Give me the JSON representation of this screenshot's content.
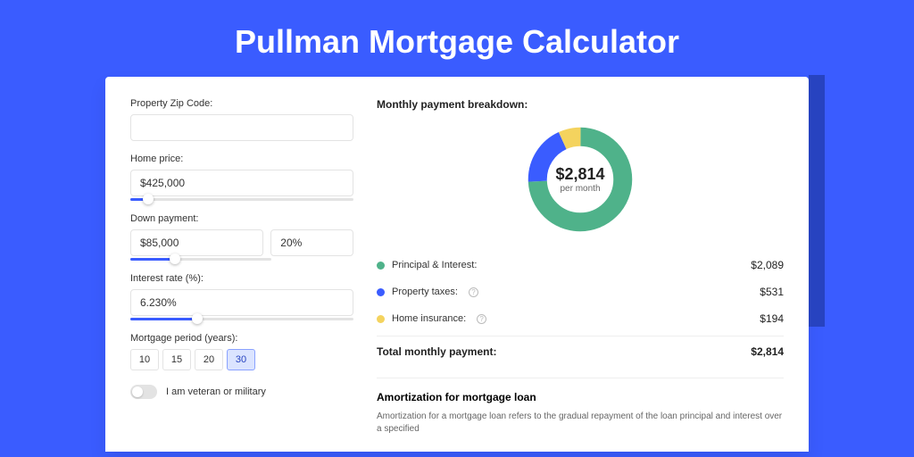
{
  "page_title": "Pullman Mortgage Calculator",
  "inputs": {
    "zip_label": "Property Zip Code:",
    "zip_value": "",
    "home_price_label": "Home price:",
    "home_price_value": "$425,000",
    "home_price_slider_pct": 8,
    "down_payment_label": "Down payment:",
    "down_payment_amount": "$85,000",
    "down_payment_pct": "20%",
    "down_payment_slider_pct": 20,
    "interest_label": "Interest rate (%):",
    "interest_value": "6.230%",
    "interest_slider_pct": 30,
    "period_label": "Mortgage period (years):",
    "periods": [
      "10",
      "15",
      "20",
      "30"
    ],
    "period_selected": "30",
    "veteran_label": "I am veteran or military"
  },
  "breakdown": {
    "title": "Monthly payment breakdown:",
    "center_amount": "$2,814",
    "center_sub": "per month",
    "items": [
      {
        "label": "Principal & Interest:",
        "value": "$2,089",
        "color": "#4fb28a",
        "info": false
      },
      {
        "label": "Property taxes:",
        "value": "$531",
        "color": "#3a5cff",
        "info": true
      },
      {
        "label": "Home insurance:",
        "value": "$194",
        "color": "#f4d35e",
        "info": true
      }
    ],
    "total_label": "Total monthly payment:",
    "total_value": "$2,814"
  },
  "amortization": {
    "title": "Amortization for mortgage loan",
    "text": "Amortization for a mortgage loan refers to the gradual repayment of the loan principal and interest over a specified"
  },
  "chart_data": {
    "type": "pie",
    "title": "Monthly payment breakdown",
    "series": [
      {
        "name": "Principal & Interest",
        "value": 2089,
        "color": "#4fb28a"
      },
      {
        "name": "Property taxes",
        "value": 531,
        "color": "#3a5cff"
      },
      {
        "name": "Home insurance",
        "value": 194,
        "color": "#f4d35e"
      }
    ],
    "total": 2814,
    "center_label": "$2,814 per month"
  }
}
